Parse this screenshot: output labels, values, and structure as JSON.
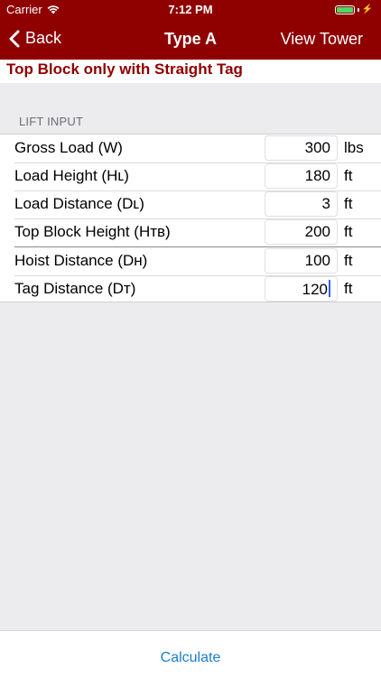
{
  "status": {
    "carrier": "Carrier",
    "time": "7:12 PM"
  },
  "nav": {
    "back_label": "Back",
    "title": "Type A",
    "right_label": "View Tower"
  },
  "subtitle": "Top Block only with Straight Tag",
  "section_header": "LIFT INPUT",
  "rows": [
    {
      "label": "Gross Load (W)",
      "value": "300",
      "unit": "lbs"
    },
    {
      "label": "Load Height (Hʟ)",
      "value": "180",
      "unit": "ft"
    },
    {
      "label": "Load Distance (Dʟ)",
      "value": "3",
      "unit": "ft"
    },
    {
      "label": "Top Block Height (Hᴛʙ)",
      "value": "200",
      "unit": "ft"
    },
    {
      "label": "Hoist Distance (Dʜ)",
      "value": "100",
      "unit": "ft"
    },
    {
      "label": "Tag Distance (Dᴛ)",
      "value": "120",
      "unit": "ft"
    }
  ],
  "bottom": {
    "calculate_label": "Calculate"
  },
  "colors": {
    "nav_background": "#8f0000",
    "subtitle_text": "#8f0000",
    "link_blue": "#1a7fc9",
    "battery_green": "#4cd964"
  }
}
